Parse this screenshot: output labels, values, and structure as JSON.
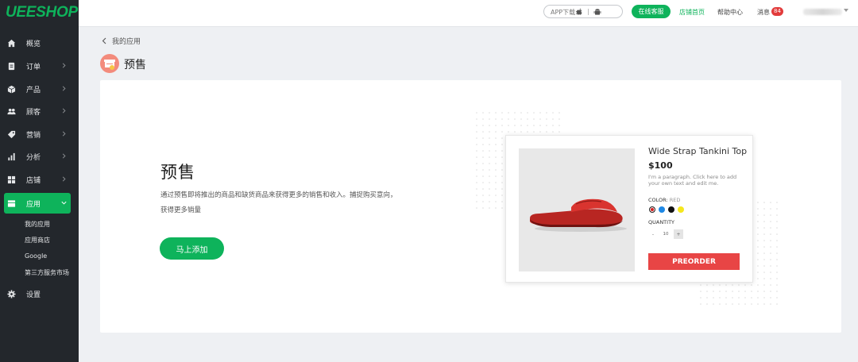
{
  "brand": {
    "logo": "UEESHOP"
  },
  "sidebar": {
    "items": [
      {
        "label": "概览",
        "icon": "home-icon"
      },
      {
        "label": "订单",
        "icon": "order-icon"
      },
      {
        "label": "产品",
        "icon": "product-icon"
      },
      {
        "label": "顾客",
        "icon": "customers-icon"
      },
      {
        "label": "营销",
        "icon": "marketing-tag-icon"
      },
      {
        "label": "分析",
        "icon": "analytics-icon"
      },
      {
        "label": "店铺",
        "icon": "store-icon"
      },
      {
        "label": "应用",
        "icon": "apps-icon",
        "active": true
      },
      {
        "label": "设置",
        "icon": "gear-icon"
      }
    ],
    "submenu": [
      "我的应用",
      "应用商店",
      "Google",
      "第三方服务市场"
    ]
  },
  "topbar": {
    "app_download": "APP下载:",
    "online_service": "在线客服",
    "shop_home": "店铺首页",
    "help_center": "帮助中心",
    "messages": "消息",
    "message_count": "84"
  },
  "breadcrumb": {
    "back_label": "我的应用"
  },
  "page": {
    "title": "预售"
  },
  "hero": {
    "title": "预售",
    "description": "通过预售即将推出的商品和缺货商品来获得更多的销售和收入。捕捉购买意向，获得更多销量",
    "add_button": "马上添加"
  },
  "preview": {
    "product_name": "Wide Strap Tankini Top",
    "price": "$100",
    "paragraph": "I'm a paragraph. Click here to add your own text and edit me.",
    "color_label": "COLOR:",
    "color_value": "RED",
    "swatches": [
      "#d62020",
      "#1e88e5",
      "#111111",
      "#f5e71e"
    ],
    "quantity_label": "QUANTITY",
    "quantity_minus": "-",
    "quantity_value": "10",
    "quantity_plus": "+",
    "preorder_button": "PREORDER"
  },
  "colors": {
    "accent": "#0eb35b",
    "sidebar_bg": "#23272c",
    "danger": "#e84545"
  }
}
